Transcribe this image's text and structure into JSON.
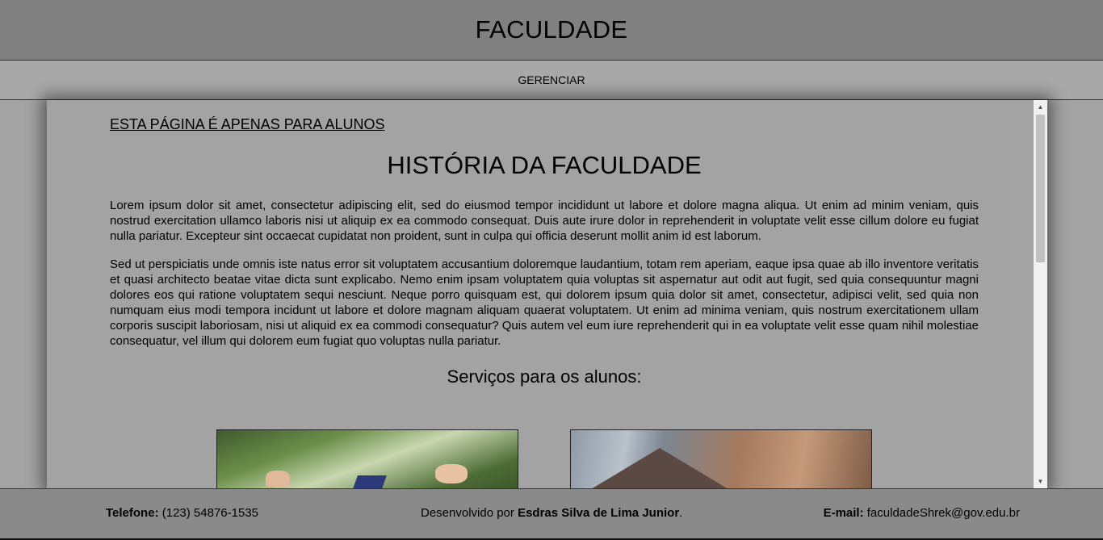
{
  "header": {
    "title": "FACULDADE"
  },
  "nav": {
    "manage": "GERENCIAR"
  },
  "main": {
    "notice": "ESTA PÁGINA É APENAS PARA ALUNOS",
    "title": "HISTÓRIA DA FACULDADE",
    "paragraph1": "Lorem ipsum dolor sit amet, consectetur adipiscing elit, sed do eiusmod tempor incididunt ut labore et dolore magna aliqua. Ut enim ad minim veniam, quis nostrud exercitation ullamco laboris nisi ut aliquip ex ea commodo consequat. Duis aute irure dolor in reprehenderit in voluptate velit esse cillum dolore eu fugiat nulla pariatur. Excepteur sint occaecat cupidatat non proident, sunt in culpa qui officia deserunt mollit anim id est laborum.",
    "paragraph2": "Sed ut perspiciatis unde omnis iste natus error sit voluptatem accusantium doloremque laudantium, totam rem aperiam, eaque ipsa quae ab illo inventore veritatis et quasi architecto beatae vitae dicta sunt explicabo. Nemo enim ipsam voluptatem quia voluptas sit aspernatur aut odit aut fugit, sed quia consequuntur magni dolores eos qui ratione voluptatem sequi nesciunt. Neque porro quisquam est, qui dolorem ipsum quia dolor sit amet, consectetur, adipisci velit, sed quia non numquam eius modi tempora incidunt ut labore et dolore magnam aliquam quaerat voluptatem. Ut enim ad minima veniam, quis nostrum exercitationem ullam corporis suscipit laboriosam, nisi ut aliquid ex ea commodi consequatur? Quis autem vel eum iure reprehenderit qui in ea voluptate velit esse quam nihil molestiae consequatur, vel illum qui dolorem eum fugiat quo voluptas nulla pariatur.",
    "services_title": "Serviços para os alunos:"
  },
  "footer": {
    "phone_label": "Telefone:",
    "phone_value": " (123) 54876-1535",
    "dev_prefix": "Desenvolvido por ",
    "dev_name": "Esdras Silva de Lima Junior",
    "dev_suffix": ".",
    "email_label": "E-mail:",
    "email_value": " faculdadeShrek@gov.edu.br"
  }
}
